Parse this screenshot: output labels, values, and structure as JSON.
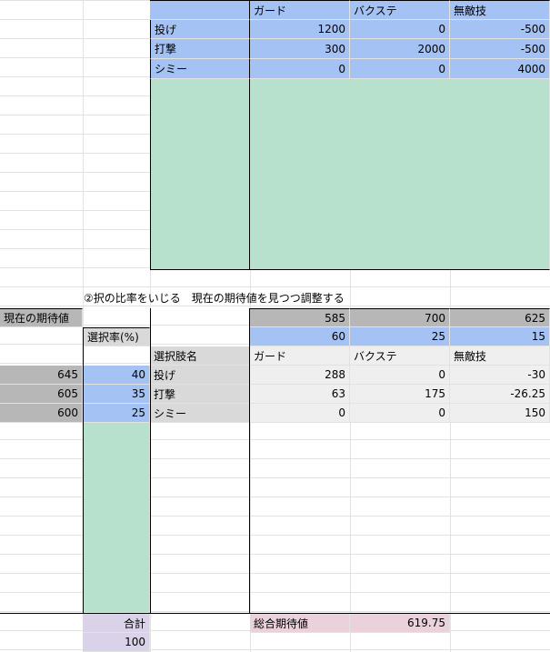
{
  "top_table": {
    "headers": [
      "ガード",
      "バクステ",
      "無敵技"
    ],
    "rows": [
      {
        "label": "投げ",
        "values": [
          "1200",
          "0",
          "-500"
        ]
      },
      {
        "label": "打撃",
        "values": [
          "300",
          "2000",
          "-500"
        ]
      },
      {
        "label": "シミー",
        "values": [
          "0",
          "0",
          "4000"
        ]
      }
    ]
  },
  "note": "②択の比率をいじる　現在の期待値を見つつ調整する",
  "expected_label": "現在の期待値",
  "expected_top": [
    "585",
    "700",
    "625"
  ],
  "opponent_rates": [
    "60",
    "25",
    "15"
  ],
  "selection_rate_label": "選択率(%)",
  "option_name_label": "選択肢名",
  "bottom_headers": [
    "ガード",
    "バクステ",
    "無敵技"
  ],
  "bottom_rows": [
    {
      "expected": "645",
      "rate": "40",
      "label": "投げ",
      "values": [
        "288",
        "0",
        "-30"
      ]
    },
    {
      "expected": "605",
      "rate": "35",
      "label": "打撃",
      "values": [
        "63",
        "175",
        "-26.25"
      ]
    },
    {
      "expected": "600",
      "rate": "25",
      "label": "シミー",
      "values": [
        "0",
        "0",
        "150"
      ]
    }
  ],
  "total_label": "合計",
  "total_value": "100",
  "overall_label": "総合期待値",
  "overall_value": "619.75",
  "colors": {
    "blue": "#a4c2f4",
    "green": "#b7e1cd",
    "gray": "#b7b7b7",
    "light_gray": "#d9d9d9",
    "purple": "#d9d2e9",
    "pink": "#ead1dc"
  }
}
